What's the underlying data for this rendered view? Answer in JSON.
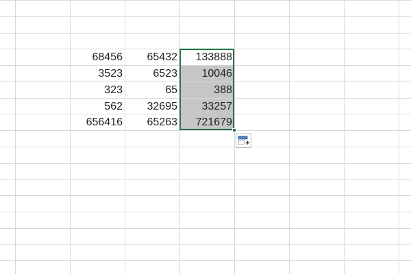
{
  "grid": {
    "rows": [
      {
        "a": "68456",
        "b": "65432",
        "sum": "133888"
      },
      {
        "a": "3523",
        "b": "6523",
        "sum": "10046"
      },
      {
        "a": "323",
        "b": "65",
        "sum": "388"
      },
      {
        "a": "562",
        "b": "32695",
        "sum": "33257"
      },
      {
        "a": "656416",
        "b": "65263",
        "sum": "721679"
      }
    ]
  },
  "icons": {
    "fill_options": "auto-fill-options-icon"
  },
  "colors": {
    "selection_border": "#217346",
    "selected_fill": "#c6c6c6",
    "gridline": "#d9d9d9",
    "text": "#222222"
  }
}
